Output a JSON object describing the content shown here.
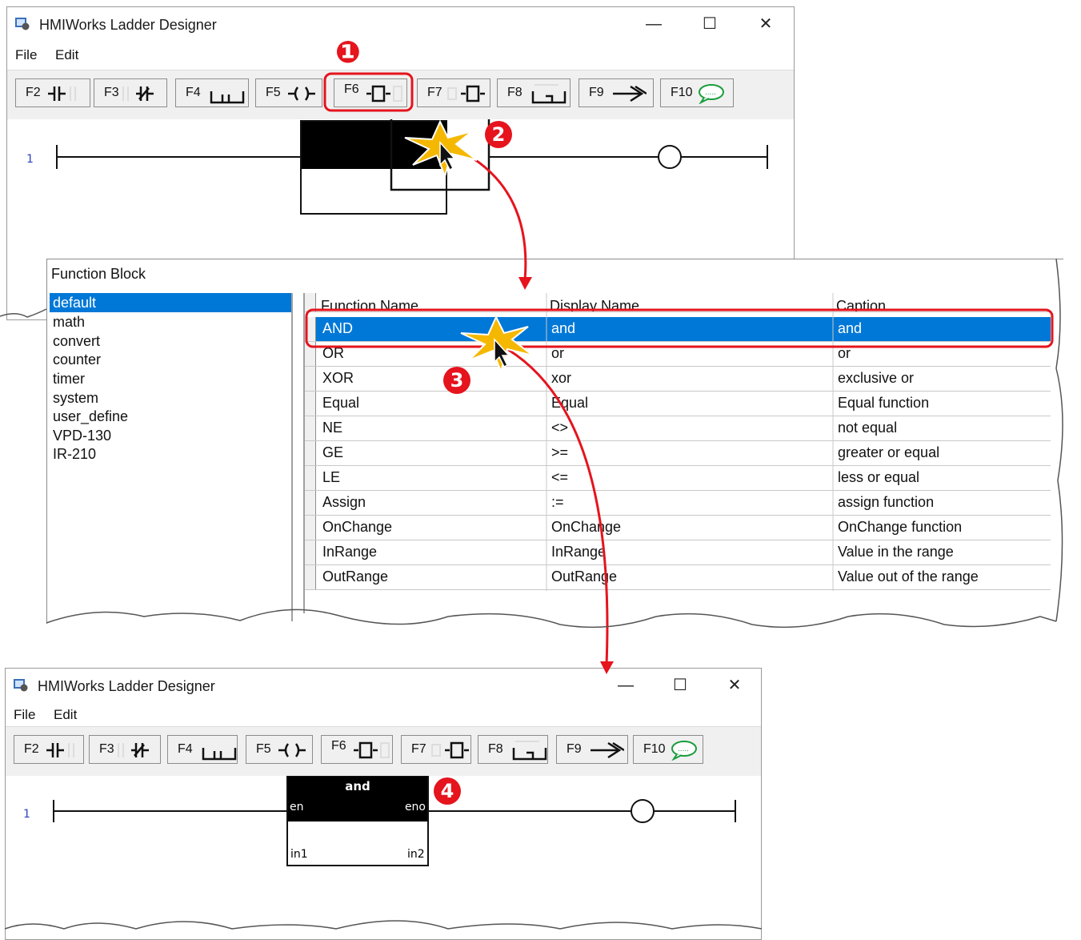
{
  "window": {
    "title": "HMIWorks Ladder Designer",
    "minimize": "—",
    "maximize": "☐",
    "close": "✕"
  },
  "menu": [
    "File",
    "Edit"
  ],
  "toolbar": [
    {
      "key": "F2",
      "icon": "contact-no-icon"
    },
    {
      "key": "F3",
      "icon": "contact-nc-icon"
    },
    {
      "key": "F4",
      "icon": "parallel-branch-icon"
    },
    {
      "key": "F5",
      "icon": "coil-icon"
    },
    {
      "key": "F6",
      "icon": "function-block-icon"
    },
    {
      "key": "F7",
      "icon": "function-block-alt-icon"
    },
    {
      "key": "F8",
      "icon": "branch-down-icon"
    },
    {
      "key": "F9",
      "icon": "jump-arrow-icon"
    },
    {
      "key": "F10",
      "icon": "comment-icon"
    }
  ],
  "rung_number": "1",
  "dialog": {
    "title": "Function Block",
    "categories": [
      "default",
      "math",
      "convert",
      "counter",
      "timer",
      "system",
      "user_define",
      "VPD-130",
      "IR-210"
    ],
    "selected_category": "default",
    "columns": [
      "Function Name",
      "Display Name",
      "Caption"
    ],
    "rows": [
      [
        "AND",
        "and",
        "and"
      ],
      [
        "OR",
        "or",
        "or"
      ],
      [
        "XOR",
        "xor",
        "exclusive or"
      ],
      [
        "Equal",
        "Equal",
        "Equal function"
      ],
      [
        "NE",
        "<>",
        "not equal"
      ],
      [
        "GE",
        ">=",
        "greater or equal"
      ],
      [
        "LE",
        "<=",
        "less or equal"
      ],
      [
        "Assign",
        ":=",
        "assign function"
      ],
      [
        "OnChange",
        "OnChange",
        "OnChange function"
      ],
      [
        "InRange",
        "InRange",
        "Value in the range"
      ],
      [
        "OutRange",
        "OutRange",
        "Value out of the range"
      ]
    ],
    "selected_row": "AND"
  },
  "function_block": {
    "name": "and",
    "en": "en",
    "eno": "eno",
    "in1": "in1",
    "in2": "in2"
  },
  "steps": [
    "❶",
    "2",
    "3",
    "4"
  ],
  "colors": {
    "accent": "#0078d7",
    "highlight": "#e5141d",
    "burst": "#f5b800"
  }
}
